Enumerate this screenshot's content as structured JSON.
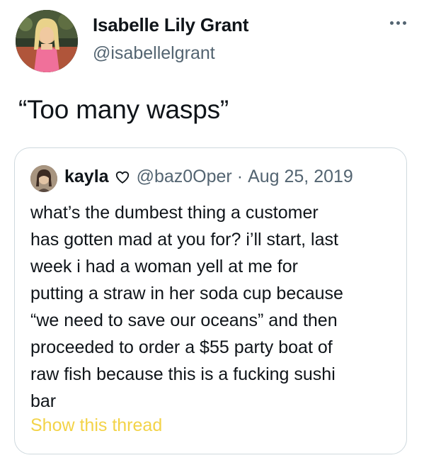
{
  "tweet": {
    "author_name": "Isabelle Lily Grant",
    "author_handle": "@isabellelgrant",
    "avatar_icon": "profile-photo",
    "more_icon": "more-options-icon",
    "text": "“Too many wasps”"
  },
  "quoted_tweet": {
    "author_name": "kayla",
    "heart_icon": "heart-outline-icon",
    "author_handle": "@baz0Oper",
    "separator": "·",
    "date": "Aug 25, 2019",
    "body_lines": [
      "what’s the dumbest thing a customer",
      "has gotten mad at you for? i’ll start, last",
      "week i had a woman yell at me for",
      "putting a straw in her soda cup because",
      "“we need to save our oceans” and then",
      "proceeded to order a $55 party boat of",
      "raw fish because this is a fucking sushi",
      "bar"
    ],
    "show_thread_label": "Show this thread"
  },
  "colors": {
    "text_primary": "#0f1419",
    "text_secondary": "#536471",
    "border": "#cfd9de",
    "link": "#f3d348"
  }
}
